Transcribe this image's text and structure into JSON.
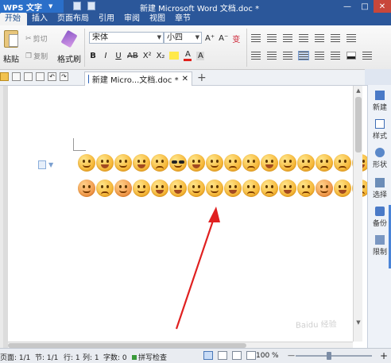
{
  "titlebar": {
    "app_name": "WPS 文字",
    "app_dropdown_glyph": "▼",
    "title": "新建 Microsoft Word 文档.doc *",
    "minimize": "—",
    "maximize": "□",
    "close": "✕"
  },
  "menu": {
    "tabs": [
      {
        "label": "开始"
      },
      {
        "label": "插入"
      },
      {
        "label": "页面布局"
      },
      {
        "label": "引用"
      },
      {
        "label": "审阅"
      },
      {
        "label": "视图"
      },
      {
        "label": "章节"
      }
    ]
  },
  "ribbon": {
    "paste_label": "粘贴",
    "cut_label": "剪切",
    "copy_label": "复制",
    "format_painter_label": "格式刷",
    "font_name": "宋体",
    "font_size": "小四",
    "grow_font": "A⁺",
    "shrink_font": "A⁻",
    "bold": "B",
    "italic": "I",
    "underline": "U",
    "strike": "AB",
    "superscript": "X²",
    "subscript": "X₂",
    "font_color": "A",
    "char_shading": "A",
    "clear_format": "变"
  },
  "quickbar": {
    "doc_tab_title": "新建 Micro...文档.doc *",
    "doc_tab_close": "✕",
    "new_tab": "+"
  },
  "task_pane": {
    "items": [
      {
        "label": "新建",
        "icon": "new-doc-icon"
      },
      {
        "label": "样式",
        "icon": "style-icon"
      },
      {
        "label": "形状",
        "icon": "shape-icon"
      },
      {
        "label": "选择",
        "icon": "select-icon"
      },
      {
        "label": "备份",
        "icon": "backup-icon"
      },
      {
        "label": "限制",
        "icon": "restrict-icon"
      }
    ]
  },
  "document": {
    "emoji_rows": [
      {
        "count": 16
      },
      {
        "count": 16
      }
    ]
  },
  "statusbar": {
    "page": "页面: 1/1",
    "section": "节: 1/1",
    "row": "行: 1",
    "col": "列: 1",
    "words": "字数: 0",
    "spellcheck": "拼写检查",
    "zoom": "100 %",
    "zoom_minus": "—",
    "zoom_plus": "+"
  },
  "annotation": {
    "arrow_color": "#e02020"
  },
  "watermark": {
    "text": "Baidu 经验"
  }
}
